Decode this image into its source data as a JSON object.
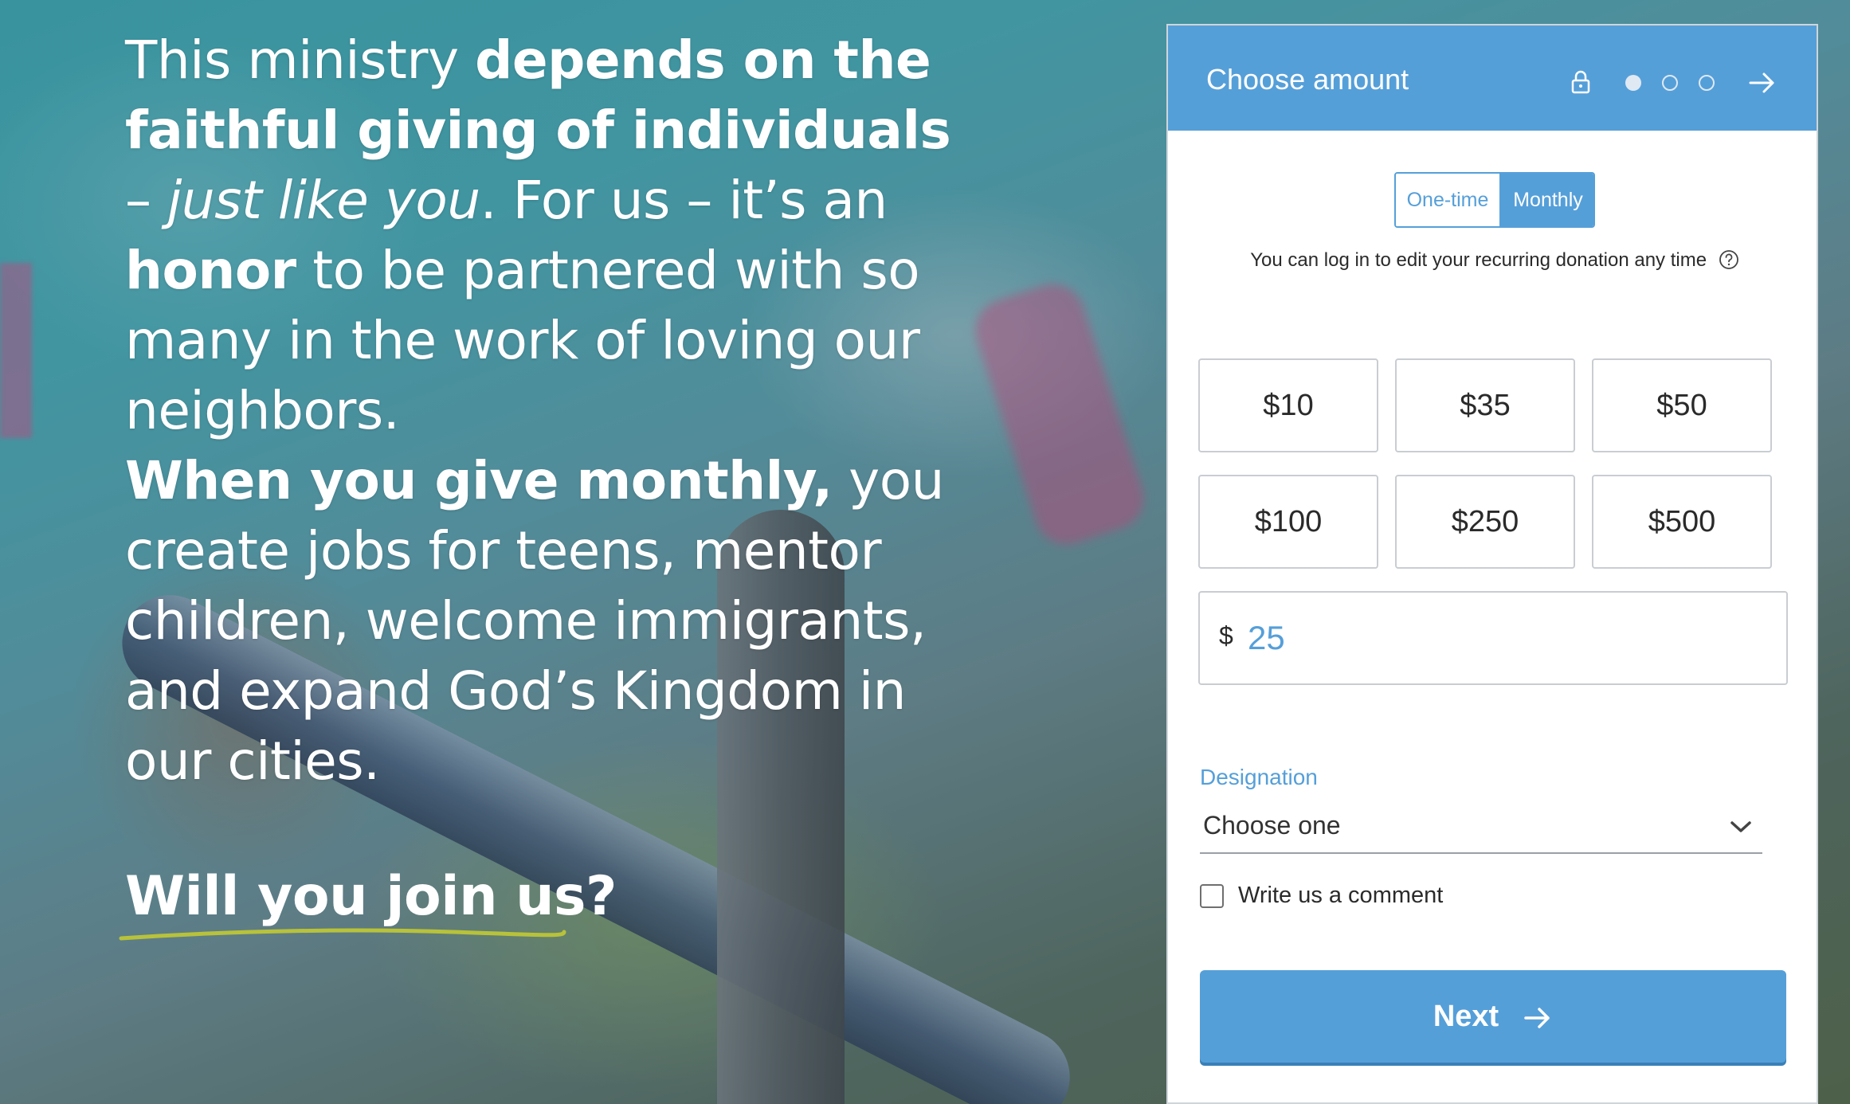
{
  "hero": {
    "p1_a": "This ministry ",
    "p1_b": "depends on the faithful giving of individuals",
    "p1_c": " – ",
    "p1_d": "just like you",
    "p1_e": ". For us – it’s an ",
    "p1_f": "honor",
    "p1_g": " to be partnered with so many in the work of loving our neighbors.",
    "p2_a": "When you give monthly,",
    "p2_b": " you create jobs for teens, mentor children, welcome immigrants, and expand God’s Kingdom in our cities.",
    "cta": "Will you join us?",
    "underline_color": "#b8c23a"
  },
  "form": {
    "title": "Choose amount",
    "accent_color": "#559fd9",
    "frequency": {
      "options": [
        "One-time",
        "Monthly"
      ],
      "selected": "Monthly"
    },
    "recurring_note": "You can log in to edit your recurring donation any time",
    "amounts": [
      "$10",
      "$35",
      "$50",
      "$100",
      "$250",
      "$500"
    ],
    "custom_amount": {
      "currency": "$",
      "value": "25"
    },
    "designation": {
      "label": "Designation",
      "selected": "Choose one"
    },
    "comment_label": "Write us a comment",
    "comment_checked": false,
    "next_label": "Next",
    "steps": {
      "current": 1,
      "total": 3
    }
  }
}
